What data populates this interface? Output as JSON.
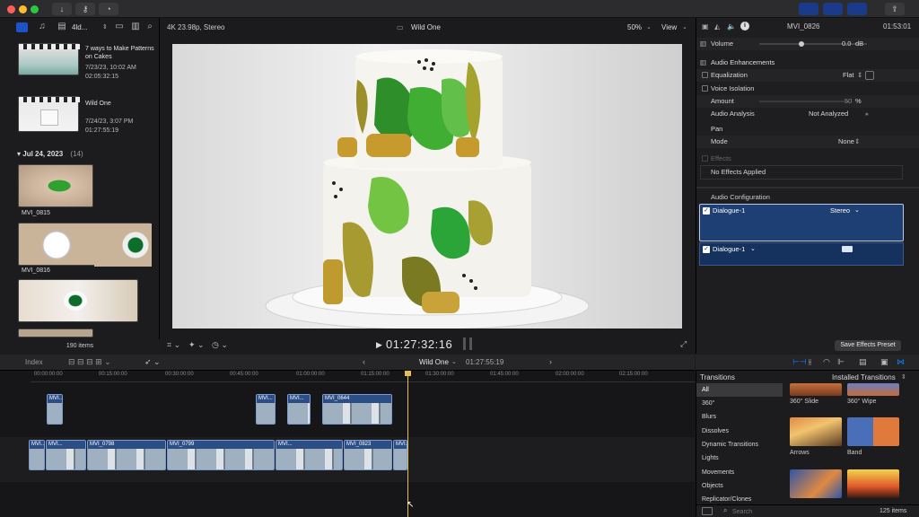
{
  "browser": {
    "view_label": "4ld...",
    "clips": [
      {
        "title": "7 ways to Make Patterns on Cakes",
        "date": "7/23/23, 10:02 AM",
        "duration": "02:05:32:15"
      },
      {
        "title": "Wild One",
        "date": "7/24/23, 3:07 PM",
        "duration": "01:27:55:19"
      }
    ],
    "group": {
      "label": "Jul 24, 2023",
      "count": "(14)"
    },
    "thumbs": [
      "MVI_0815",
      "MVI_0816"
    ],
    "count": "190 items"
  },
  "viewer": {
    "format": "4K 23.98p, Stereo",
    "title": "Wild One",
    "zoom": "50%",
    "view": "View",
    "timecode": "01:27:32:16"
  },
  "inspector": {
    "clip_name": "MVI_0826",
    "duration": "01:53:01",
    "volume": {
      "label": "Volume",
      "value": "0.0",
      "unit": "dB"
    },
    "enh": "Audio Enhancements",
    "eq": {
      "label": "Equalization",
      "value": "Flat"
    },
    "vi": {
      "label": "Voice Isolation",
      "amount_label": "Amount",
      "amount_value": "50",
      "unit": "%"
    },
    "analysis": {
      "label": "Audio Analysis",
      "value": "Not Analyzed"
    },
    "pan": {
      "label": "Pan",
      "mode_label": "Mode",
      "mode_value": "None"
    },
    "effects": {
      "label": "Effects",
      "empty": "No Effects Applied"
    },
    "config": "Audio Configuration",
    "channels": [
      {
        "name": "Dialogue-1",
        "mode": "Stereo"
      },
      {
        "name": "Dialogue-1",
        "mode": ""
      }
    ],
    "save": "Save Effects Preset"
  },
  "timeline": {
    "index": "Index",
    "project": "Wild One",
    "duration": "01:27:55:19",
    "ruler": [
      "00:00:00:00",
      "00:15:00:00",
      "00:30:00:00",
      "00:45:00:00",
      "01:00:00:00",
      "01:15:00:00",
      "01:30:00:00",
      "01:45:00:00",
      "02:00:00:00",
      "02:15:00:00"
    ],
    "clips_top": [
      "MVI...",
      "MVI...",
      "MVI...",
      "MVI_0644"
    ],
    "clips_main": [
      "MVI...",
      "MVI...",
      "MVI_0798",
      "MVI_0799",
      "MVI_0823"
    ]
  },
  "transitions": {
    "title": "Transitions",
    "installed": "Installed Transitions",
    "categories": [
      "All",
      "360°",
      "Blurs",
      "Dissolves",
      "Dynamic Transitions",
      "Lights",
      "Movements",
      "Objects",
      "Replicator/Clones"
    ],
    "items": [
      "360° Slide",
      "360° Wipe",
      "Arrows",
      "Band"
    ],
    "search": "Search",
    "count": "125 items"
  },
  "colors": {
    "accent": "#0a84ff",
    "selection": "#1d3f73"
  }
}
